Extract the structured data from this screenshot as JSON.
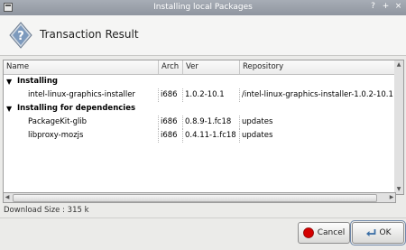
{
  "window": {
    "title": "Installing local Packages",
    "controls": [
      "?",
      "+",
      "×"
    ]
  },
  "header": {
    "title": "Transaction Result"
  },
  "table": {
    "columns": [
      "Name",
      "Arch",
      "Ver",
      "Repository"
    ],
    "groups": [
      {
        "label": "Installing",
        "rows": [
          {
            "name": "intel-linux-graphics-installer",
            "arch": "i686",
            "ver": "1.0.2-10.1",
            "repo": "/intel-linux-graphics-installer-1.0.2-10.1"
          }
        ]
      },
      {
        "label": "Installing for dependencies",
        "rows": [
          {
            "name": "PackageKit-glib",
            "arch": "i686",
            "ver": "0.8.9-1.fc18",
            "repo": "updates"
          },
          {
            "name": "libproxy-mozjs",
            "arch": "i686",
            "ver": "0.4.11-1.fc18",
            "repo": "updates"
          }
        ]
      }
    ],
    "expander_glyph": "▼"
  },
  "download_size": "Download Size : 315 k",
  "buttons": {
    "cancel": "Cancel",
    "ok": "OK"
  },
  "colors": {
    "titlebar": "#9aa0aa",
    "cancel_icon": "#d40000",
    "ok_icon": "#3a6ea5"
  }
}
